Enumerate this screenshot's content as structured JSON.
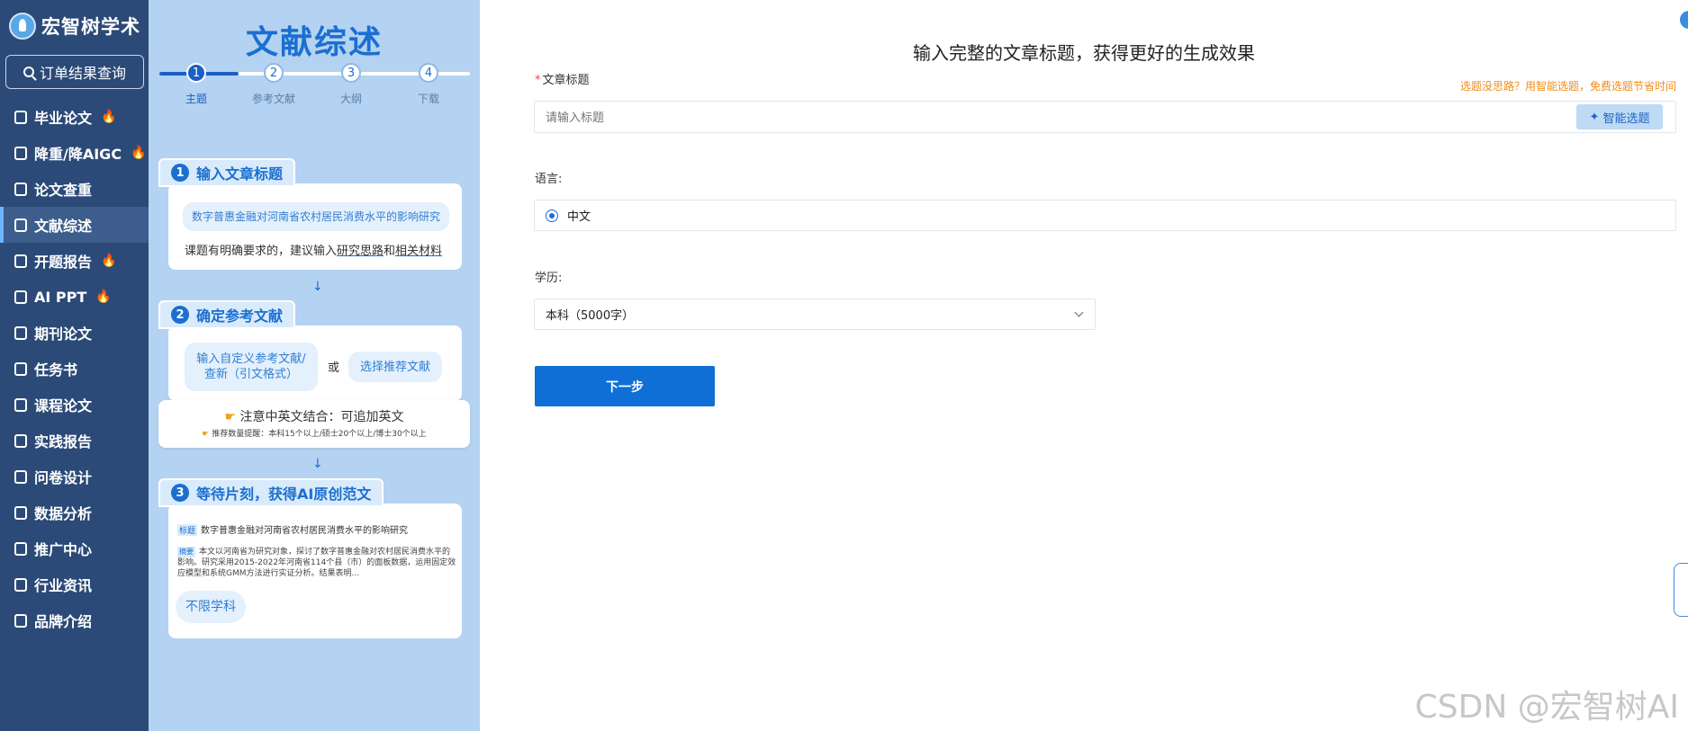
{
  "brand": {
    "name": "宏智树学术"
  },
  "sidebar": {
    "order_query": "订单结果查询",
    "items": [
      {
        "label": "毕业论文",
        "hot": true,
        "icon": "graduation-cap-icon"
      },
      {
        "label": "降重/降AIGC",
        "hot": true,
        "icon": "bus-icon"
      },
      {
        "label": "论文查重",
        "hot": false,
        "icon": "document-check-icon"
      },
      {
        "label": "文献综述",
        "hot": false,
        "icon": "list-doc-icon",
        "active": true
      },
      {
        "label": "开题报告",
        "hot": true,
        "icon": "report-icon"
      },
      {
        "label": "AI PPT",
        "hot": true,
        "icon": "ppt-icon"
      },
      {
        "label": "期刊论文",
        "hot": false,
        "icon": "journal-icon"
      },
      {
        "label": "任务书",
        "hot": false,
        "icon": "task-icon"
      },
      {
        "label": "课程论文",
        "hot": false,
        "icon": "course-icon"
      },
      {
        "label": "实践报告",
        "hot": false,
        "icon": "practice-icon"
      },
      {
        "label": "问卷设计",
        "hot": false,
        "icon": "survey-icon"
      },
      {
        "label": "数据分析",
        "hot": false,
        "icon": "chart-icon"
      },
      {
        "label": "推广中心",
        "hot": false,
        "icon": "grid-icon"
      },
      {
        "label": "行业资讯",
        "hot": false,
        "icon": "news-icon"
      },
      {
        "label": "品牌介绍",
        "hot": false,
        "icon": "registered-icon"
      }
    ]
  },
  "guide": {
    "title": "文献综述",
    "steps": [
      {
        "num": "1",
        "label": "主题"
      },
      {
        "num": "2",
        "label": "参考文献"
      },
      {
        "num": "3",
        "label": "大纲"
      },
      {
        "num": "4",
        "label": "下载"
      }
    ],
    "sec1": {
      "num": "1",
      "title": "输入文章标题",
      "example": "数字普惠金融对河南省农村居民消费水平的影响研究",
      "note_prefix": "课题有明确要求的，建议输入",
      "note_link1": "研究思路",
      "note_mid": "和",
      "note_link2": "相关材料"
    },
    "sec2": {
      "num": "2",
      "title": "确定参考文献",
      "custom": "输入自定义参考文献/查新（引文格式）",
      "or": "或",
      "recommend": "选择推荐文献",
      "tip_main": "注意中英文结合：可追加英文",
      "tip_sub": "推荐数量提醒：本科15个以上/硕士20个以上/博士30个以上"
    },
    "sec3": {
      "num": "3",
      "title": "等待片刻，获得AI原创范文",
      "title_tag": "标题",
      "example_title": "数字普惠金融对河南省农村居民消费水平的影响研究",
      "abstract_tag": "摘要",
      "abstract": "本文以河南省为研究对象，探讨了数字普惠金融对农村居民消费水平的影响。研究采用2015-2022年河南省114个县（市）的面板数据，运用固定效应模型和系统GMM方法进行实证分析。结果表明...",
      "badge": "不限学科"
    }
  },
  "form": {
    "heading": "输入完整的文章标题，获得更好的生成效果",
    "title_label": "文章标题",
    "title_hint": "选题没思路？用智能选题，免费选题节省时间",
    "title_placeholder": "请输入标题",
    "smart_button": "智能选题",
    "lang_label": "语言:",
    "lang_value": "中文",
    "edu_label": "学历:",
    "edu_value": "本科（5000字）",
    "next_button": "下一步"
  },
  "watermark": "CSDN @宏智树AI",
  "colors": {
    "sidebar": "#2b4a77",
    "accent": "#0f6fd6",
    "guide_bg": "#b4d2f1",
    "hint": "#f28c1a"
  }
}
